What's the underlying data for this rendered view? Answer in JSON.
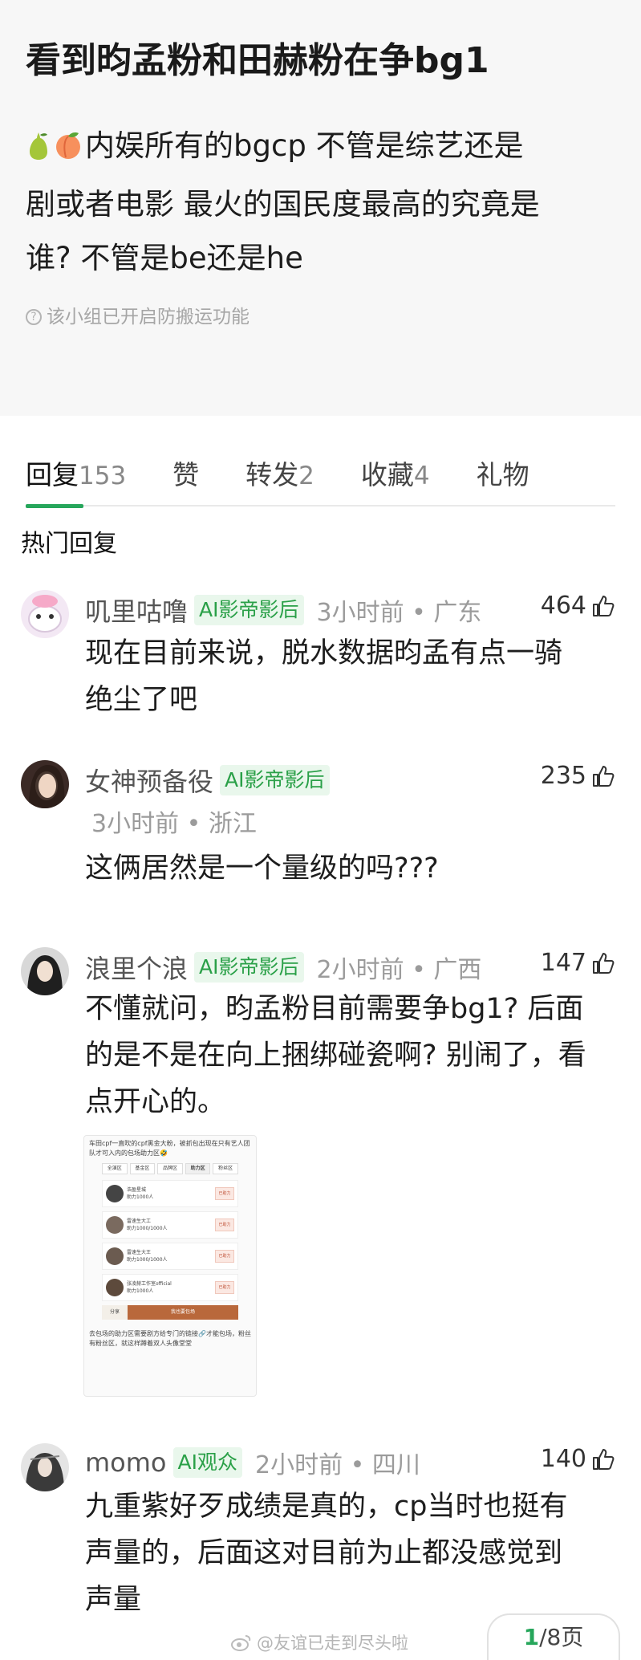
{
  "post": {
    "title": "看到昀孟粉和田赫粉在争bg1",
    "body_line1": "内娱所有的bgcp 不管是综艺还是",
    "body_line2": "剧或者电影 最火的国民度最高的究竟是",
    "body_line3": "谁? 不管是be还是he",
    "notice": "该小组已开启防搬运功能",
    "icons": [
      "pear-icon",
      "peach-icon",
      "help-circle-icon"
    ]
  },
  "tabs": [
    {
      "label": "回复",
      "count": "153"
    },
    {
      "label": "赞",
      "count": ""
    },
    {
      "label": "转发",
      "count": "2"
    },
    {
      "label": "收藏",
      "count": "4"
    },
    {
      "label": "礼物",
      "count": ""
    }
  ],
  "section_title": "热门回复",
  "comments": [
    {
      "user": "叽里咕噜",
      "badge": "AI影帝影后",
      "time": "3小时前 • 广东",
      "likes": "464",
      "lines": [
        "现在目前来说，脱水数据昀孟有点一骑",
        "绝尘了吧"
      ]
    },
    {
      "user": "女神预备役",
      "badge": "AI影帝影后",
      "time": "3小时前 • 浙江",
      "likes": "235",
      "lines": [
        "这俩居然是一个量级的吗???"
      ]
    },
    {
      "user": "浪里个浪",
      "badge": "AI影帝影后",
      "time": "2小时前 • 广西",
      "likes": "147",
      "lines": [
        "不懂就问，昀孟粉目前需要争bg1? 后面",
        "的是不是在向上捆绑碰瓷啊? 别闹了，看",
        "点开心的。"
      ]
    },
    {
      "user": "momo",
      "badge": "AI观众",
      "time": "2小时前 • 四川",
      "likes": "140",
      "lines": [
        "九重紫好歹成绩是真的，cp当时也挺有",
        "声量的，后面这对目前为止都没感觉到",
        "声量"
      ]
    }
  ],
  "embedded_screenshot": {
    "caption": "车田cpf一直吹的cpf黑金大粉，被抓包出现在只有艺人团队才可入内的包场助力区🤣",
    "tabs": [
      "全演区",
      "基金区",
      "品牌区",
      "助力区",
      "粉丝区"
    ],
    "rows": [
      {
        "name": "浩盈星城",
        "sub": "助力1000人",
        "btn": "已助力"
      },
      {
        "name": "雷速生大工",
        "sub": "助力1000/1000人",
        "btn": "已助力"
      },
      {
        "name": "雷速生大王",
        "sub": "助力1000/1000人",
        "btn": "已助力"
      },
      {
        "name": "张凌赫工作室official",
        "sub": "助力1000人",
        "btn": "已助力"
      }
    ],
    "bar_left": "分享",
    "bar_right": "我也要包场",
    "footer": "去包场的助力区需要剧方给专门的链接🔗才能包场，粉丝有粉丝区，就这样蹲着双人头像堂堂"
  },
  "watermark": "@友谊已走到尽头啦",
  "pager": {
    "current": "1",
    "rest": "/8页"
  },
  "colors": {
    "accent": "#26a65b",
    "badge_bg": "#e9f7ec",
    "post_bg": "#f7f7f7"
  }
}
